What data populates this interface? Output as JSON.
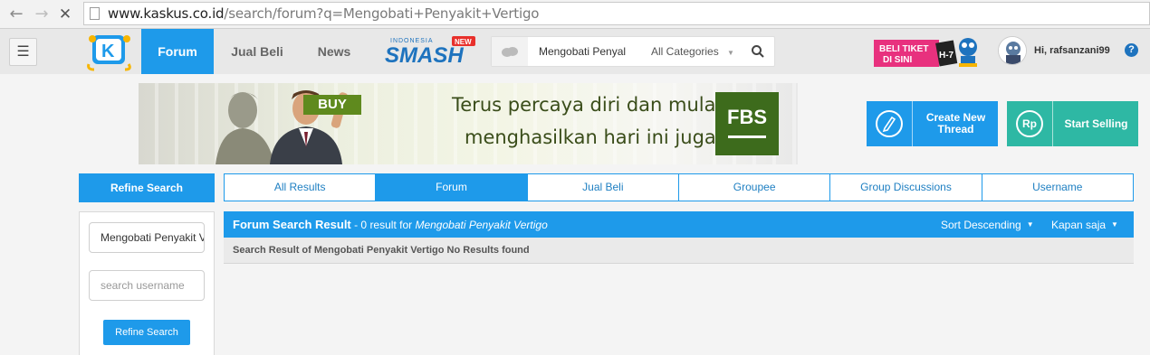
{
  "browser": {
    "url_domain": "www.kaskus.co.id",
    "url_path": "/search/forum?q=Mengobati+Penyakit+Vertigo"
  },
  "header": {
    "tabs": [
      {
        "label": "Forum",
        "active": true
      },
      {
        "label": "Jual Beli",
        "active": false
      },
      {
        "label": "News",
        "active": false
      }
    ],
    "smash_top": "INDONESIA",
    "smash_text": "SMASH",
    "smash_badge": "NEW",
    "search_value": "Mengobati Penyal",
    "category": "All Categories",
    "promo_line1": "BELI TIKET",
    "promo_line2": "DI SINI",
    "promo_badge": "H-7",
    "user_greeting": "Hi, rafsanzani99",
    "help": "?",
    "colors": {
      "accent": "#1e9aea",
      "teal": "#2eb8a4"
    }
  },
  "banner": {
    "buy": "BUY",
    "line1": "Terus percaya diri dan mulai",
    "line2": "menghasilkan hari ini juga!",
    "logo": "FBS"
  },
  "actions": {
    "create_label": "Create New Thread",
    "sell_icon": "Rp",
    "sell_label": "Start Selling"
  },
  "refine": {
    "header": "Refine Search",
    "keyword_value": "Mengobati Penyakit Vertigo",
    "username_placeholder": "search username",
    "button": "Refine Search"
  },
  "result_tabs": [
    {
      "label": "All Results",
      "active": false
    },
    {
      "label": "Forum",
      "active": true
    },
    {
      "label": "Jual Beli",
      "active": false
    },
    {
      "label": "Groupee",
      "active": false
    },
    {
      "label": "Group Discussions",
      "active": false
    },
    {
      "label": "Username",
      "active": false
    }
  ],
  "results": {
    "title": "Forum Search Result",
    "count_text": " - 0 result for ",
    "query": "Mengobati Penyakit Vertigo",
    "sort": "Sort Descending",
    "time": "Kapan saja",
    "message": "Search Result of Mengobati Penyakit Vertigo No Results found"
  }
}
